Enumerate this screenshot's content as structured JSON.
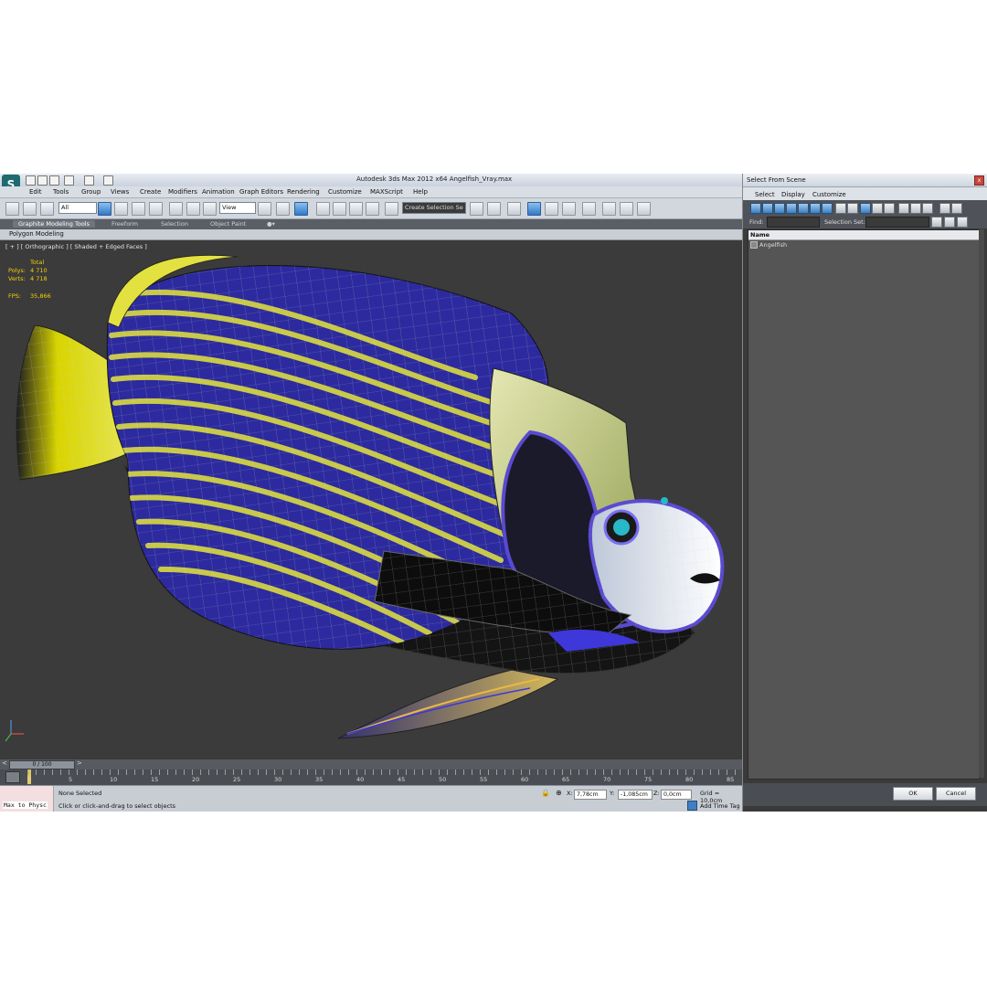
{
  "window": {
    "title": "Autodesk 3ds Max  2012 x64      Angelfish_Vray.max"
  },
  "menu": [
    "Edit",
    "Tools",
    "Group",
    "Views",
    "Create",
    "Modifiers",
    "Animation",
    "Graph Editors",
    "Rendering",
    "Customize",
    "MAXScript",
    "Help"
  ],
  "toolbar": {
    "filter_value": "All",
    "refcoord_value": "View",
    "named_selection_value": "Create Selection Se"
  },
  "ribbon": {
    "tabs": [
      "Graphite Modeling Tools",
      "Freeform",
      "Selection",
      "Object Paint"
    ],
    "panel": "Polygon Modeling"
  },
  "viewport": {
    "label": "[ + ] [ Orthographic ] [ Shaded + Edged Faces ]",
    "stats": {
      "total_label": "Total",
      "polys_label": "Polys:",
      "polys_value": "4 710",
      "verts_label": "Verts:",
      "verts_value": "4 718",
      "fps_label": "FPS:",
      "fps_value": "35,866"
    }
  },
  "timeline": {
    "frame_display": "0 / 100",
    "ticks": [
      "0",
      "5",
      "10",
      "15",
      "20",
      "25",
      "30",
      "35",
      "40",
      "45",
      "50",
      "55",
      "60",
      "65",
      "70",
      "75",
      "80",
      "85"
    ]
  },
  "status": {
    "script_listener": "Max to Physc",
    "selection": "None Selected",
    "prompt": "Click or click-and-drag to select objects",
    "x_label": "X:",
    "x_value": "7,78cm",
    "y_label": "Y:",
    "y_value": "-1,085cm",
    "z_label": "Z:",
    "z_value": "0,0cm",
    "grid": "Grid = 10,0cm",
    "add_time_tag": "Add Time Tag"
  },
  "dialog": {
    "title": "Select From Scene",
    "close_label": "x",
    "menu": [
      "Select",
      "Display",
      "Customize"
    ],
    "find_label": "Find:",
    "selection_set_label": "Selection Set:",
    "column_name": "Name",
    "items": [
      "Angelfish"
    ],
    "ok_label": "OK",
    "cancel_label": "Cancel"
  },
  "colors": {
    "viewport_bg": "#3b3b3b",
    "fish_blue": "#2c2a9e",
    "fish_yellow": "#c8c84a",
    "stat_text": "#f2d200"
  }
}
